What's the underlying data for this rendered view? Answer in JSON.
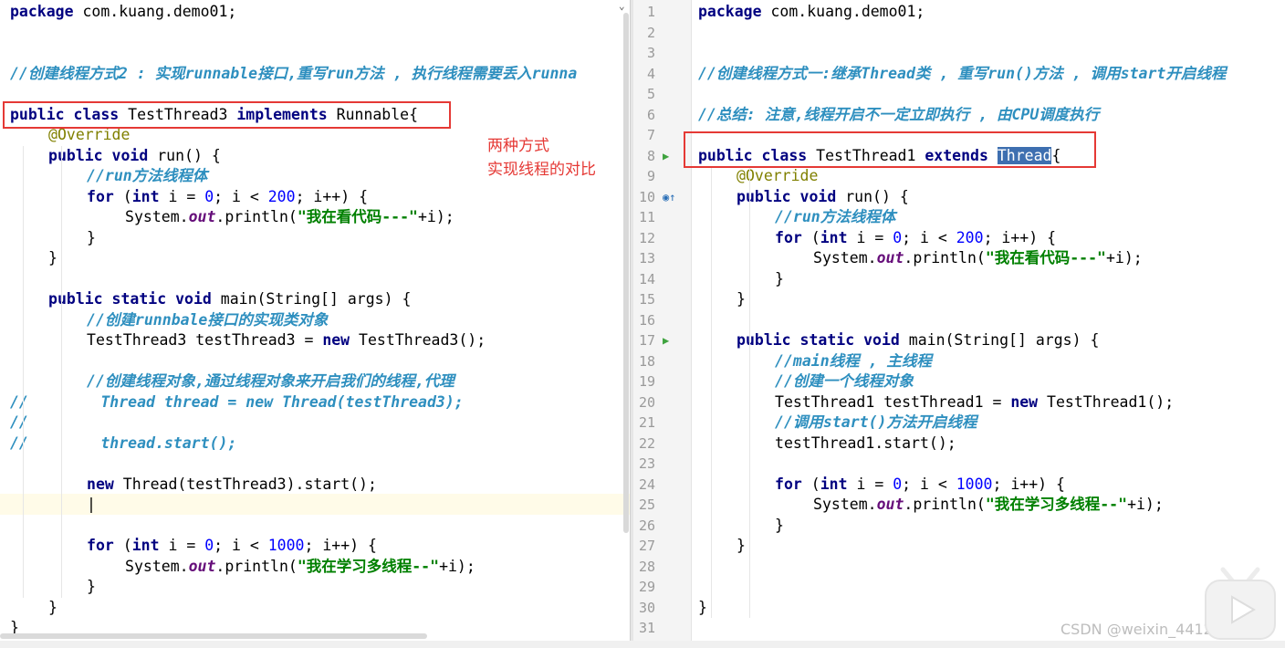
{
  "left": {
    "lines": [
      {
        "indent": 0,
        "tokens": [
          {
            "c": "kw",
            "t": "package"
          },
          {
            "t": " com.kuang.demo01;"
          }
        ]
      },
      {
        "indent": 0,
        "tokens": []
      },
      {
        "indent": 0,
        "tokens": []
      },
      {
        "indent": 0,
        "tokens": [
          {
            "c": "cm",
            "t": "//创建线程方式2 : 实现runnable接口,重写run方法 , 执行线程需要丢入runna"
          }
        ]
      },
      {
        "indent": 0,
        "tokens": []
      },
      {
        "indent": 0,
        "tokens": [
          {
            "c": "kw",
            "t": "public class"
          },
          {
            "t": " TestThread3 "
          },
          {
            "c": "kw",
            "t": "implements"
          },
          {
            "t": " Runnable{"
          }
        ]
      },
      {
        "indent": 1,
        "tokens": [
          {
            "c": "ann",
            "t": "@Override"
          }
        ]
      },
      {
        "indent": 1,
        "tokens": [
          {
            "c": "kw",
            "t": "public void"
          },
          {
            "t": " run() {"
          }
        ]
      },
      {
        "indent": 2,
        "tokens": [
          {
            "c": "cm",
            "t": "//run方法线程体"
          }
        ]
      },
      {
        "indent": 2,
        "tokens": [
          {
            "c": "kw",
            "t": "for"
          },
          {
            "t": " ("
          },
          {
            "c": "kw",
            "t": "int"
          },
          {
            "t": " i = "
          },
          {
            "c": "num",
            "t": "0"
          },
          {
            "t": "; i < "
          },
          {
            "c": "num",
            "t": "200"
          },
          {
            "t": "; i++) {"
          }
        ]
      },
      {
        "indent": 3,
        "tokens": [
          {
            "t": "System."
          },
          {
            "c": "fld",
            "t": "out"
          },
          {
            "t": ".println("
          },
          {
            "c": "str",
            "t": "\"我在看代码---\""
          },
          {
            "t": "+i);"
          }
        ]
      },
      {
        "indent": 2,
        "tokens": [
          {
            "t": "}"
          }
        ]
      },
      {
        "indent": 1,
        "tokens": [
          {
            "t": "}"
          }
        ]
      },
      {
        "indent": 0,
        "tokens": []
      },
      {
        "indent": 1,
        "tokens": [
          {
            "c": "kw",
            "t": "public static void"
          },
          {
            "t": " main(String[] args) {"
          }
        ]
      },
      {
        "indent": 2,
        "tokens": [
          {
            "c": "cm",
            "t": "//创建runnbale接口的实现类对象"
          }
        ]
      },
      {
        "indent": 2,
        "tokens": [
          {
            "t": "TestThread3 testThread3 = "
          },
          {
            "c": "kw",
            "t": "new"
          },
          {
            "t": " TestThread3();"
          }
        ]
      },
      {
        "indent": 0,
        "tokens": []
      },
      {
        "indent": 2,
        "tokens": [
          {
            "c": "cm",
            "t": "//创建线程对象,通过线程对象来开启我们的线程,代理"
          }
        ]
      },
      {
        "indent": 0,
        "tokens": [
          {
            "c": "cm",
            "t": "//        Thread thread = new Thread(testThread3);"
          }
        ]
      },
      {
        "indent": 0,
        "tokens": [
          {
            "c": "cm",
            "t": "//"
          }
        ]
      },
      {
        "indent": 0,
        "tokens": [
          {
            "c": "cm",
            "t": "//        thread.start();"
          }
        ]
      },
      {
        "indent": 0,
        "tokens": []
      },
      {
        "indent": 2,
        "tokens": [
          {
            "c": "kw",
            "t": "new"
          },
          {
            "t": " Thread(testThread3).start();"
          }
        ]
      },
      {
        "indent": 2,
        "tokens": [
          {
            "t": "|"
          }
        ]
      },
      {
        "indent": 0,
        "tokens": []
      },
      {
        "indent": 2,
        "tokens": [
          {
            "c": "kw",
            "t": "for"
          },
          {
            "t": " ("
          },
          {
            "c": "kw",
            "t": "int"
          },
          {
            "t": " i = "
          },
          {
            "c": "num",
            "t": "0"
          },
          {
            "t": "; i < "
          },
          {
            "c": "num",
            "t": "1000"
          },
          {
            "t": "; i++) {"
          }
        ]
      },
      {
        "indent": 3,
        "tokens": [
          {
            "t": "System."
          },
          {
            "c": "fld",
            "t": "out"
          },
          {
            "t": ".println("
          },
          {
            "c": "str",
            "t": "\"我在学习多线程--\""
          },
          {
            "t": "+i);"
          }
        ]
      },
      {
        "indent": 2,
        "tokens": [
          {
            "t": "}"
          }
        ]
      },
      {
        "indent": 1,
        "tokens": [
          {
            "t": "}"
          }
        ]
      },
      {
        "indent": 0,
        "tokens": [
          {
            "t": "}"
          }
        ]
      }
    ]
  },
  "right": {
    "lines": [
      {
        "n": "1",
        "indent": 0,
        "tokens": [
          {
            "c": "kw",
            "t": "package"
          },
          {
            "t": " com.kuang.demo01;"
          }
        ]
      },
      {
        "n": "2",
        "indent": 0,
        "tokens": []
      },
      {
        "n": "3",
        "indent": 0,
        "tokens": []
      },
      {
        "n": "4",
        "indent": 0,
        "tokens": [
          {
            "c": "cm",
            "t": "//创建线程方式一:继承Thread类 , 重写run()方法 , 调用start开启线程"
          }
        ]
      },
      {
        "n": "5",
        "indent": 0,
        "tokens": []
      },
      {
        "n": "6",
        "indent": 0,
        "tokens": [
          {
            "c": "cm",
            "t": "//总结: 注意,线程开启不一定立即执行 , 由CPU调度执行"
          }
        ]
      },
      {
        "n": "7",
        "indent": 0,
        "tokens": []
      },
      {
        "n": "8",
        "indent": 0,
        "marker": "run",
        "tokens": [
          {
            "c": "kw",
            "t": "public class"
          },
          {
            "t": " TestThread1 "
          },
          {
            "c": "kw",
            "t": "extends"
          },
          {
            "t": " "
          },
          {
            "c": "sel",
            "t": "Thread"
          },
          {
            "t": "{"
          }
        ]
      },
      {
        "n": "9",
        "indent": 1,
        "tokens": [
          {
            "c": "ann",
            "t": "@Override"
          }
        ]
      },
      {
        "n": "10",
        "indent": 1,
        "marker": "override",
        "tokens": [
          {
            "c": "kw",
            "t": "public void"
          },
          {
            "t": " run() {"
          }
        ]
      },
      {
        "n": "11",
        "indent": 2,
        "tokens": [
          {
            "c": "cm",
            "t": "//run方法线程体"
          }
        ]
      },
      {
        "n": "12",
        "indent": 2,
        "tokens": [
          {
            "c": "kw",
            "t": "for"
          },
          {
            "t": " ("
          },
          {
            "c": "kw",
            "t": "int"
          },
          {
            "t": " i = "
          },
          {
            "c": "num",
            "t": "0"
          },
          {
            "t": "; i < "
          },
          {
            "c": "num",
            "t": "200"
          },
          {
            "t": "; i++) {"
          }
        ]
      },
      {
        "n": "13",
        "indent": 3,
        "tokens": [
          {
            "t": "System."
          },
          {
            "c": "fld",
            "t": "out"
          },
          {
            "t": ".println("
          },
          {
            "c": "str",
            "t": "\"我在看代码---\""
          },
          {
            "t": "+i);"
          }
        ]
      },
      {
        "n": "14",
        "indent": 2,
        "tokens": [
          {
            "t": "}"
          }
        ]
      },
      {
        "n": "15",
        "indent": 1,
        "tokens": [
          {
            "t": "}"
          }
        ]
      },
      {
        "n": "16",
        "indent": 0,
        "tokens": []
      },
      {
        "n": "17",
        "indent": 1,
        "marker": "run",
        "tokens": [
          {
            "c": "kw",
            "t": "public static void"
          },
          {
            "t": " main(String[] args) {"
          }
        ]
      },
      {
        "n": "18",
        "indent": 2,
        "tokens": [
          {
            "c": "cm",
            "t": "//main线程 , 主线程"
          }
        ]
      },
      {
        "n": "19",
        "indent": 2,
        "tokens": [
          {
            "c": "cm",
            "t": "//创建一个线程对象"
          }
        ]
      },
      {
        "n": "20",
        "indent": 2,
        "tokens": [
          {
            "t": "TestThread1 testThread1 = "
          },
          {
            "c": "kw",
            "t": "new"
          },
          {
            "t": " TestThread1();"
          }
        ]
      },
      {
        "n": "21",
        "indent": 2,
        "tokens": [
          {
            "c": "cm",
            "t": "//调用start()方法开启线程"
          }
        ]
      },
      {
        "n": "22",
        "indent": 2,
        "tokens": [
          {
            "t": "testThread1.start();"
          }
        ]
      },
      {
        "n": "23",
        "indent": 0,
        "tokens": []
      },
      {
        "n": "24",
        "indent": 2,
        "tokens": [
          {
            "c": "kw",
            "t": "for"
          },
          {
            "t": " ("
          },
          {
            "c": "kw",
            "t": "int"
          },
          {
            "t": " i = "
          },
          {
            "c": "num",
            "t": "0"
          },
          {
            "t": "; i < "
          },
          {
            "c": "num",
            "t": "1000"
          },
          {
            "t": "; i++) {"
          }
        ]
      },
      {
        "n": "25",
        "indent": 3,
        "tokens": [
          {
            "t": "System."
          },
          {
            "c": "fld",
            "t": "out"
          },
          {
            "t": ".println("
          },
          {
            "c": "str",
            "t": "\"我在学习多线程--\""
          },
          {
            "t": "+i);"
          }
        ]
      },
      {
        "n": "26",
        "indent": 2,
        "tokens": [
          {
            "t": "}"
          }
        ]
      },
      {
        "n": "27",
        "indent": 1,
        "tokens": [
          {
            "t": "}"
          }
        ]
      },
      {
        "n": "28",
        "indent": 0,
        "tokens": []
      },
      {
        "n": "29",
        "indent": 0,
        "tokens": []
      },
      {
        "n": "30",
        "indent": 0,
        "tokens": [
          {
            "t": "}"
          }
        ]
      },
      {
        "n": "31",
        "indent": 0,
        "tokens": []
      }
    ]
  },
  "annotation": {
    "line1": "两种方式",
    "line2": "实现线程的对比"
  },
  "watermark": "CSDN @weixin_44124248",
  "icons": {
    "run_marker": "run-gutter-icon",
    "override_marker": "override-gutter-icon",
    "logo": "bilibili-tv-icon"
  },
  "colors": {
    "keyword": "#000080",
    "comment": "#2e8fbf",
    "string": "#008000",
    "number": "#0000ff",
    "annotation": "#808000",
    "highlight_box": "#e53935",
    "selection": "#3e6fb0"
  }
}
